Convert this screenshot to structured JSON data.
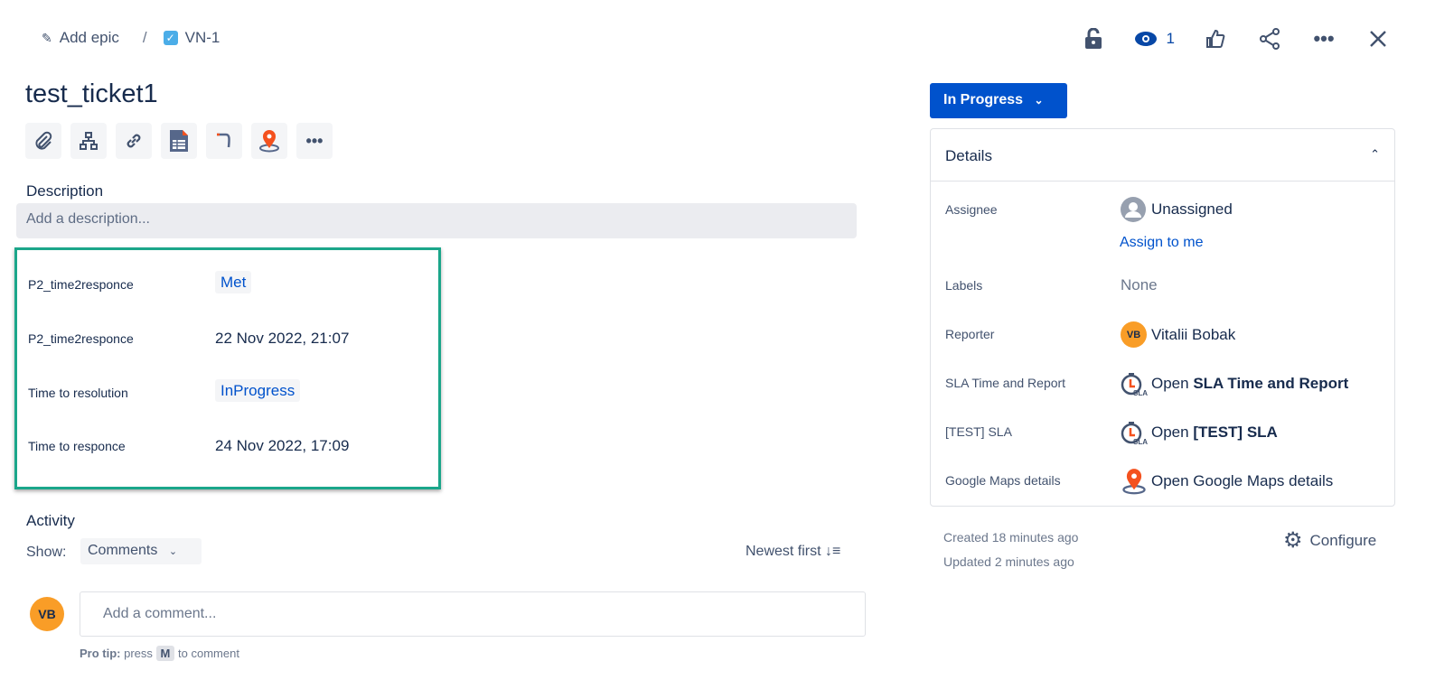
{
  "breadcrumb": {
    "epic": "Add epic",
    "separator": "/",
    "issue_key": "VN-1"
  },
  "header": {
    "watch_count": "1"
  },
  "issue": {
    "title": "test_ticket1"
  },
  "description": {
    "label": "Description",
    "placeholder": "Add a description..."
  },
  "sla_fields": [
    {
      "label": "P2_time2responce",
      "value": "Met",
      "lozenge": true
    },
    {
      "label": "P2_time2responce",
      "value": "22 Nov 2022, 21:07",
      "lozenge": false
    },
    {
      "label": "Time to resolution",
      "value": "InProgress",
      "lozenge": true
    },
    {
      "label": "Time to responce",
      "value": "24 Nov 2022, 17:09",
      "lozenge": false
    }
  ],
  "activity": {
    "title": "Activity",
    "show_label": "Show:",
    "filter": "Comments",
    "sort": "Newest first",
    "avatar": "VB",
    "comment_placeholder": "Add a comment...",
    "tip_bold": "Pro tip:",
    "tip_pre": "press",
    "tip_key": "M",
    "tip_post": "to comment"
  },
  "status": {
    "label": "In Progress"
  },
  "details": {
    "title": "Details",
    "assignee_label": "Assignee",
    "assignee": "Unassigned",
    "assign_to_me": "Assign to me",
    "labels_label": "Labels",
    "labels": "None",
    "reporter_label": "Reporter",
    "reporter_initials": "VB",
    "reporter": "Vitalii Bobak",
    "sla_label": "SLA Time and Report",
    "sla_open": "Open",
    "sla_name": "SLA Time and Report",
    "test_label": "[TEST] SLA",
    "test_open": "Open",
    "test_name": "[TEST] SLA",
    "maps_label": "Google Maps details",
    "maps_value": "Open Google Maps details"
  },
  "meta": {
    "created": "Created 18 minutes ago",
    "updated": "Updated 2 minutes ago",
    "configure": "Configure"
  },
  "colors": {
    "primary": "#0052cc",
    "highlight": "#1ba68a",
    "avatar": "#f99d27",
    "map_pin": "#f4511e"
  }
}
